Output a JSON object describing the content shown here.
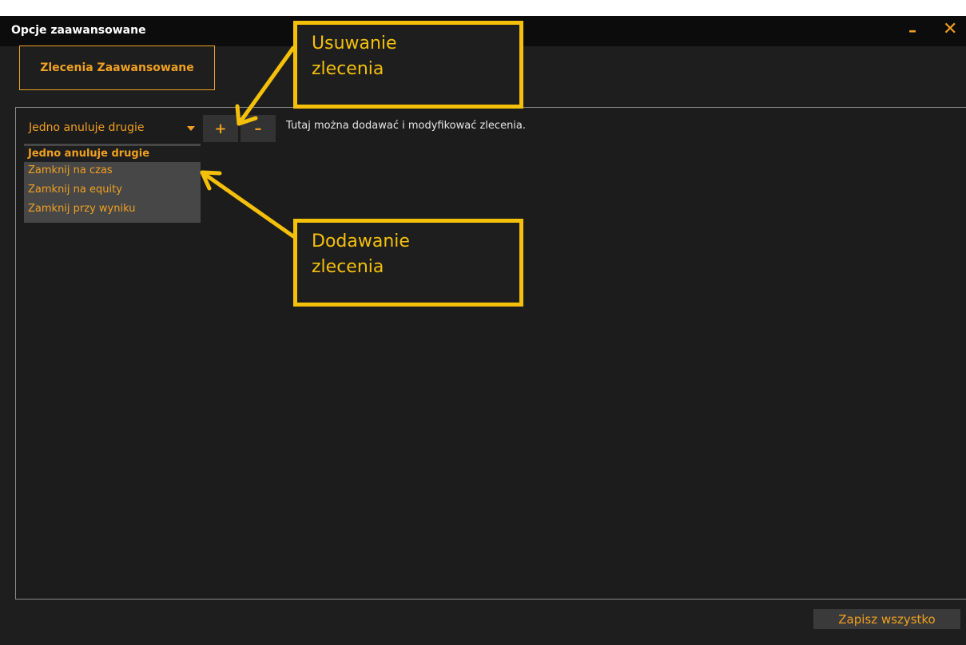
{
  "window": {
    "title": "Opcje zaawansowane",
    "minimize_glyph": "–",
    "close_glyph": "✕"
  },
  "tabs": {
    "advanced_orders": "Zlecenia Zaawansowane"
  },
  "toolbar": {
    "order_type_value": "Jedno anuluje drugie",
    "add_glyph": "+",
    "remove_glyph": "–",
    "hint": "Tutaj można dodawać i modyfikować zlecenia."
  },
  "dropdown": {
    "options": [
      "Jedno anuluje drugie",
      "Zamknij na czas",
      "Zamknij na equity",
      "Zamknij przy wyniku"
    ],
    "selected_index": 0
  },
  "footer": {
    "save_all": "Zapisz wszystko"
  },
  "annotations": {
    "remove_label_line1": "Usuwanie",
    "remove_label_line2": "zlecenia",
    "add_label_line1": "Dodawanie",
    "add_label_line2": "zlecenia"
  },
  "colors": {
    "accent": "#f0a020",
    "annotation": "#f5c00a",
    "window_bg": "#1e1e1e",
    "titlebar_bg": "#0c0c0c"
  },
  "icons": {
    "minimize": "minimize-icon",
    "close": "close-icon",
    "dropdown_arrow": "caret-down-icon",
    "add": "plus-icon",
    "remove": "minus-icon"
  }
}
